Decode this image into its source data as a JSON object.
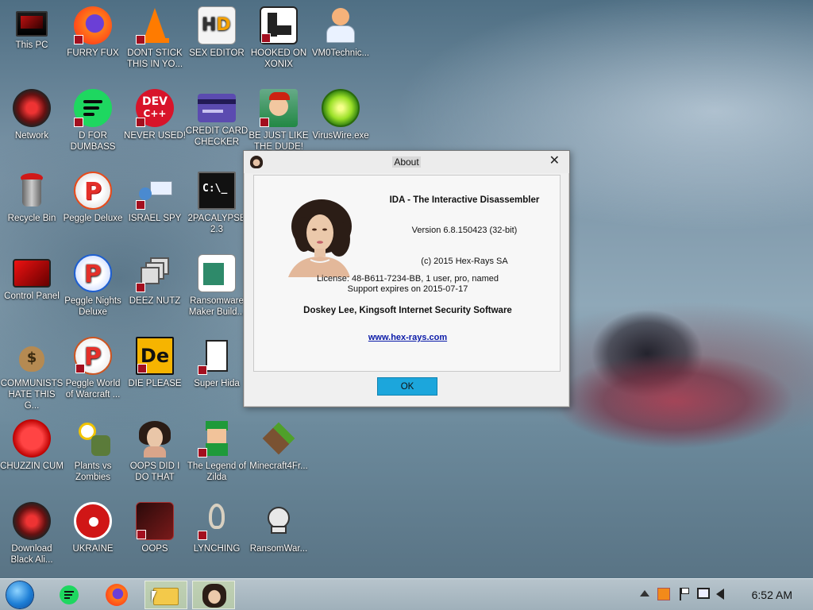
{
  "desktop": {
    "icons": [
      {
        "label": "This PC",
        "icon": "computer-icon"
      },
      {
        "label": "FURRY FUX",
        "icon": "firefox-icon"
      },
      {
        "label": "DONT STICK THIS IN YO...",
        "icon": "vlc-icon"
      },
      {
        "label": "SEX EDITOR",
        "icon": "hxd-icon"
      },
      {
        "label": "HOOKED ON XONIX",
        "icon": "xonix-icon"
      },
      {
        "label": "VM0Technic...",
        "icon": "doctor-icon"
      },
      {
        "label": "Network",
        "icon": "network-icon"
      },
      {
        "label": "D FOR DUMBASS",
        "icon": "discord-icon"
      },
      {
        "label": "NEVER USED!",
        "icon": "devcpp-icon"
      },
      {
        "label": "CREDIT CARD CHECKER",
        "icon": "credit-card-icon"
      },
      {
        "label": "BE JUST LIKE THE DUDE!",
        "icon": "dude-icon"
      },
      {
        "label": "VirusWire.exe",
        "icon": "limewire-icon"
      },
      {
        "label": "Recycle Bin",
        "icon": "recycle-bin-icon"
      },
      {
        "label": "Peggle Deluxe",
        "icon": "peggle-icon"
      },
      {
        "label": "ISRAEL SPY",
        "icon": "spy-icon"
      },
      {
        "label": "2PACALYPSE 2.3",
        "icon": "terminal-icon"
      },
      {
        "label": "Control Panel",
        "icon": "control-panel-icon"
      },
      {
        "label": "Peggle Nights Deluxe",
        "icon": "peggle-nights-icon"
      },
      {
        "label": "DEEZ NUTZ",
        "icon": "windows-stack-icon"
      },
      {
        "label": "Ransomware Maker Build...",
        "icon": "ransomware-builder-icon"
      },
      {
        "label": "COMMUNISTS HATE THIS G...",
        "icon": "money-bag-icon"
      },
      {
        "label": "Peggle World of Warcraft ...",
        "icon": "peggle-wow-icon"
      },
      {
        "label": "DIE PLEASE",
        "icon": "de-icon"
      },
      {
        "label": "Super Hida",
        "icon": "hida-icon"
      },
      {
        "label": "CHUZZIN CUM",
        "icon": "chuzzle-icon"
      },
      {
        "label": "Plants vs Zombies",
        "icon": "pvz-icon"
      },
      {
        "label": "OOPS DID I DO THAT",
        "icon": "portrait-icon"
      },
      {
        "label": "The Legend of Zilda",
        "icon": "zelda-icon"
      },
      {
        "label": "Minecraft4Fr...",
        "icon": "minecraft-icon"
      },
      {
        "label": "Download Black Ali...",
        "icon": "alienware-icon"
      },
      {
        "label": "UKRAINE",
        "icon": "radiation-icon"
      },
      {
        "label": "OOPS",
        "icon": "oops-icon"
      },
      {
        "label": "LYNCHING",
        "icon": "noose-icon"
      },
      {
        "label": "RansomWar...",
        "icon": "skull-icon"
      }
    ]
  },
  "dialog": {
    "title": "About",
    "close": "✕",
    "product": "IDA - The Interactive Disassembler",
    "version": "Version 6.8.150423 (32-bit)",
    "copyright": "(c) 2015 Hex-Rays SA",
    "license": "License: 48-B611-7234-BB, 1 user, pro, named",
    "support": "Support expires on 2015-07-17",
    "licensee": "Doskey Lee, Kingsoft Internet Security Software",
    "website": "www.hex-rays.com",
    "ok_label": "OK"
  },
  "taskbar": {
    "clock": "6:52 AM",
    "items": [
      "start-orb-icon",
      "discord-icon",
      "firefox-icon",
      "file-explorer-icon",
      "ida-portrait-icon"
    ],
    "tray": [
      "chevron-up-icon",
      "tray-app-icon",
      "flag-icon",
      "network-icon",
      "volume-icon"
    ]
  },
  "colors": {
    "accent": "#1ca6dc",
    "link": "#0a1aa8",
    "shortcut_badge": "#a30f1f"
  }
}
